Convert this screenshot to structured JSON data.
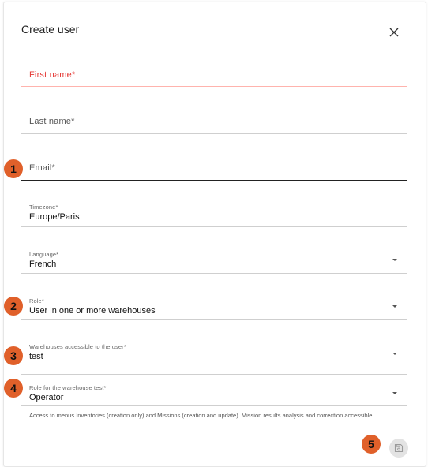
{
  "dialog": {
    "title": "Create user"
  },
  "fields": {
    "first_name": {
      "placeholder": "First name*"
    },
    "last_name": {
      "placeholder": "Last name*"
    },
    "email": {
      "placeholder": "Email*"
    },
    "timezone": {
      "label": "Timezone*",
      "value": "Europe/Paris"
    },
    "language": {
      "label": "Language*",
      "value": "French"
    },
    "role": {
      "label": "Role*",
      "value": "User in one or more warehouses"
    },
    "warehouses": {
      "label": "Warehouses accessible to the user*",
      "value": "test"
    },
    "warehouse_role": {
      "label": "Role for the warehouse test*",
      "value": "Operator",
      "help": "Access to menus Inventories (creation only) and Missions (creation and update). Mission results analysis and correction accessible"
    }
  },
  "markers": [
    "1",
    "2",
    "3",
    "4",
    "5"
  ],
  "icons": {
    "close": "close-icon",
    "dropdown": "caret-down-icon",
    "save": "save-icon"
  },
  "colors": {
    "error": "#e53935",
    "marker": "#e0602a",
    "save_button_bg": "#e3e3e3"
  }
}
